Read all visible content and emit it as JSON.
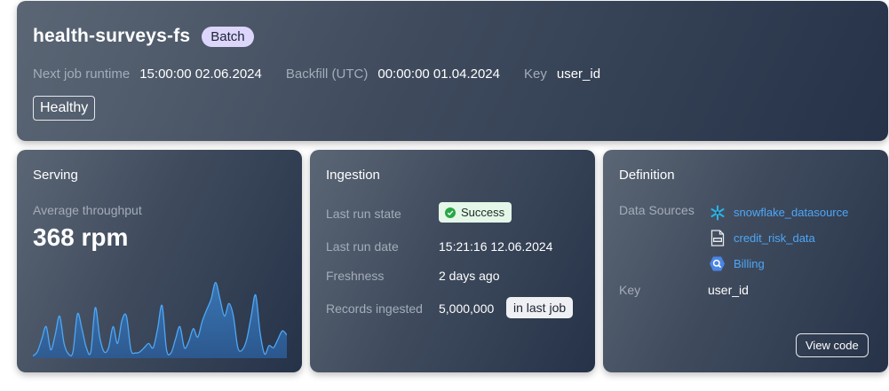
{
  "header": {
    "title": "health-surveys-fs",
    "badge": "Batch",
    "meta": [
      {
        "label": "Next job runtime",
        "value": "15:00:00 02.06.2024"
      },
      {
        "label": "Backfill (UTC)",
        "value": "00:00:00 01.04.2024"
      },
      {
        "label": "Key",
        "value": "user_id"
      }
    ],
    "status": "Healthy"
  },
  "serving": {
    "title": "Serving",
    "metric_label": "Average throughput",
    "metric_value": "368 rpm"
  },
  "chart_data": {
    "type": "area",
    "values": [
      2,
      6,
      18,
      30,
      8,
      22,
      40,
      14,
      4,
      6,
      42,
      28,
      10,
      6,
      48,
      20,
      6,
      10,
      30,
      14,
      36,
      40,
      8,
      5,
      6,
      10,
      14,
      10,
      28,
      50,
      8,
      5,
      18,
      30,
      10,
      16,
      28,
      20,
      35,
      46,
      56,
      72,
      56,
      40,
      52,
      40,
      10,
      8,
      18,
      40,
      60,
      24,
      4,
      12,
      10,
      18,
      26,
      22
    ],
    "color": "#4ea7f7"
  },
  "ingestion": {
    "title": "Ingestion",
    "rows": [
      {
        "label": "Last run state",
        "value": "Success"
      },
      {
        "label": "Last run date",
        "value": "15:21:16 12.06.2024"
      },
      {
        "label": "Freshness",
        "value": "2 days ago"
      },
      {
        "label": "Records ingested",
        "value": "5,000,000",
        "badge": "in last job"
      }
    ]
  },
  "definition": {
    "title": "Definition",
    "sources_label": "Data Sources",
    "sources": [
      {
        "name": "snowflake_datasource",
        "icon": "snowflake-icon"
      },
      {
        "name": "credit_risk_data",
        "icon": "csv-file-icon"
      },
      {
        "name": "Billing",
        "icon": "bigquery-icon"
      }
    ],
    "key_label": "Key",
    "key_value": "user_id",
    "view_code": "View code"
  },
  "colors": {
    "accent": "#4ea7f7",
    "success": "#27a745",
    "badge_purple": "#dcd6fb"
  }
}
